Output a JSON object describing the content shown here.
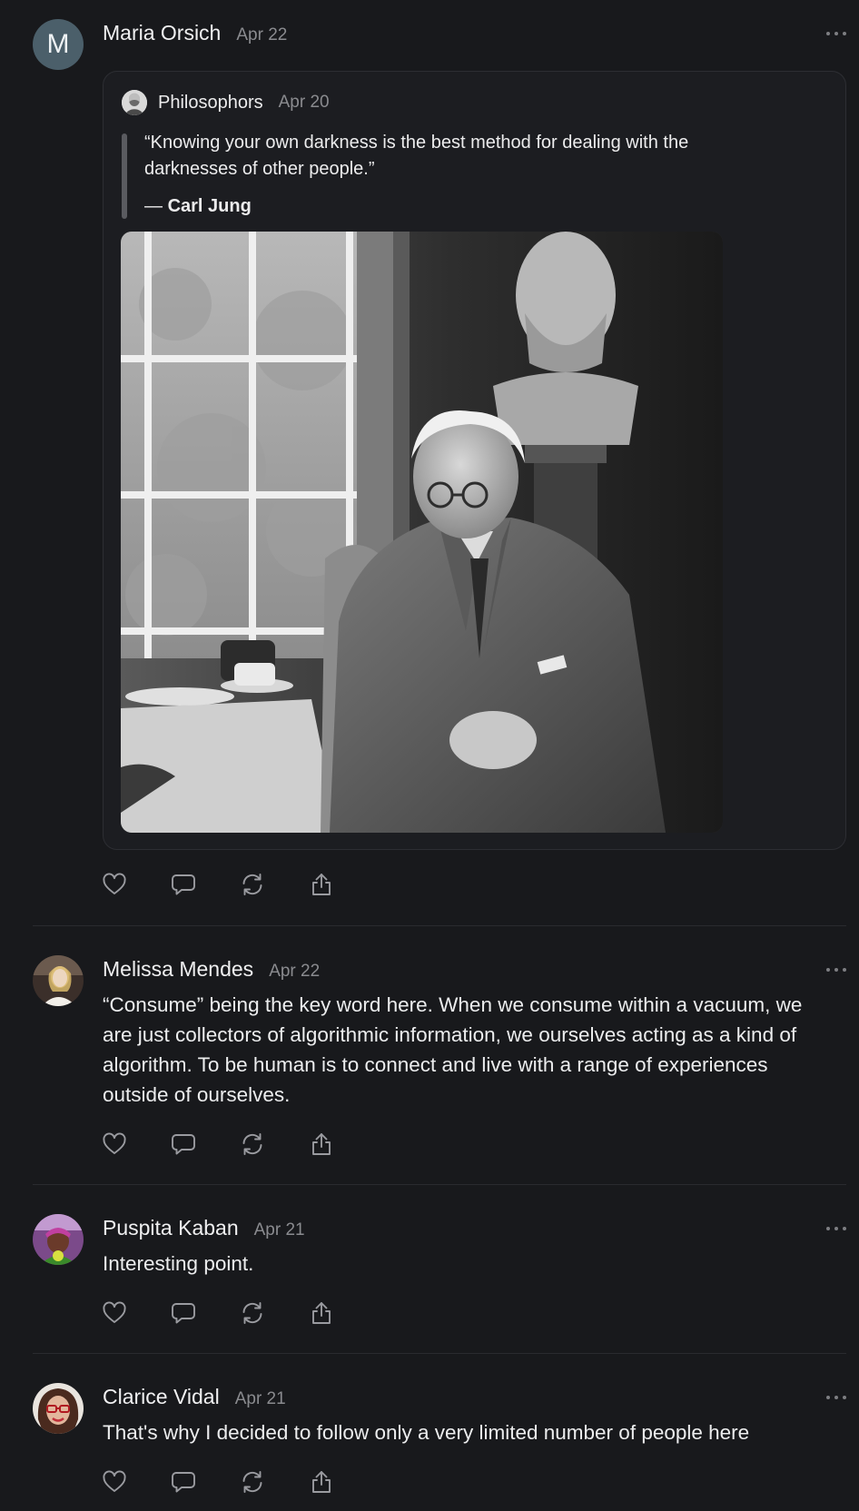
{
  "posts": [
    {
      "avatar_letter": "M",
      "name": "Maria Orsich",
      "date": "Apr 22",
      "quoted": {
        "source": "Philosophors",
        "date": "Apr 20",
        "quote": "“Knowing your own darkness is the best method for dealing with the darknesses of other people.”",
        "dash": "— ",
        "author": "Carl Jung"
      }
    },
    {
      "name": "Melissa Mendes",
      "date": "Apr 22",
      "text": "“Consume” being the key word here. When we consume within a vacuum, we are just collectors of algorithmic information, we ourselves acting as a kind of algorithm. To be human is to connect and live with a range of experiences outside of ourselves."
    },
    {
      "name": "Puspita Kaban",
      "date": "Apr 21",
      "text": "Interesting point."
    },
    {
      "name": "Clarice Vidal",
      "date": "Apr 21",
      "text": "That's why I decided to follow only a very limited number of people here"
    }
  ],
  "icons": {
    "like": "heart-icon",
    "reply": "speech-bubble-icon",
    "repost": "repost-arrows-icon",
    "share": "share-upload-icon",
    "more": "more-dots-icon"
  },
  "colors": {
    "background": "#18191c",
    "text": "#e9e9ea",
    "muted": "#8a8b8f",
    "avatar_m": "#4b5f6a"
  }
}
